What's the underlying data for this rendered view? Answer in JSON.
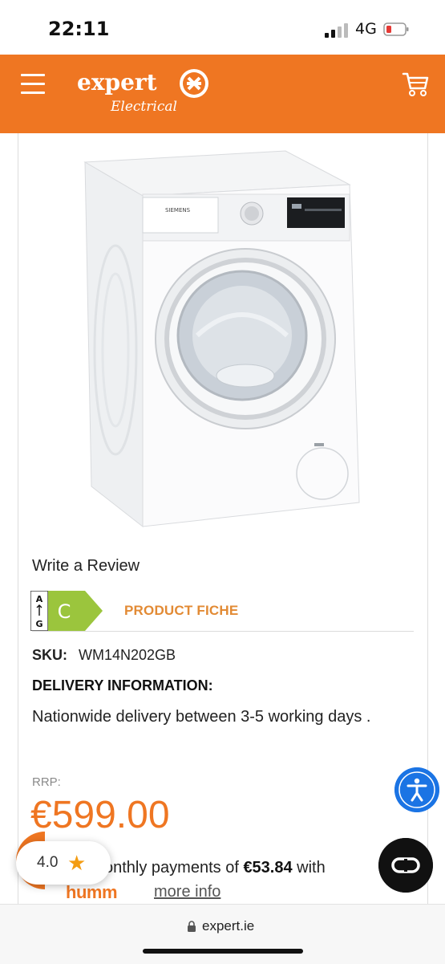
{
  "status_bar": {
    "time": "22:11",
    "network": "4G"
  },
  "header": {
    "brand": "expert",
    "tagline": "Electrical"
  },
  "product": {
    "image_brand": "SIEMENS",
    "review_label": "Write a Review",
    "energy": {
      "scale_top": "A",
      "scale_bottom": "G",
      "class": "C"
    },
    "fiche_label": "PRODUCT FICHE",
    "sku_label": "SKU:",
    "sku": "WM14N202GB",
    "delivery_title": "DELIVERY INFORMATION:",
    "delivery_text": "Nationwide delivery between 3-5 working days .",
    "rrp_label": "RRP:",
    "price": "€599.00",
    "monthly_prefix": "onthly payments of",
    "monthly_amount": "€53.84",
    "monthly_suffix": "with",
    "finance_brand": "humm",
    "more_info": "more info"
  },
  "rating": {
    "value": "4.0"
  },
  "browser": {
    "url": "expert.ie"
  },
  "colors": {
    "brand_orange": "#ef7622",
    "accessibility_blue": "#1b74e4",
    "energy_green": "#9bc53d"
  }
}
